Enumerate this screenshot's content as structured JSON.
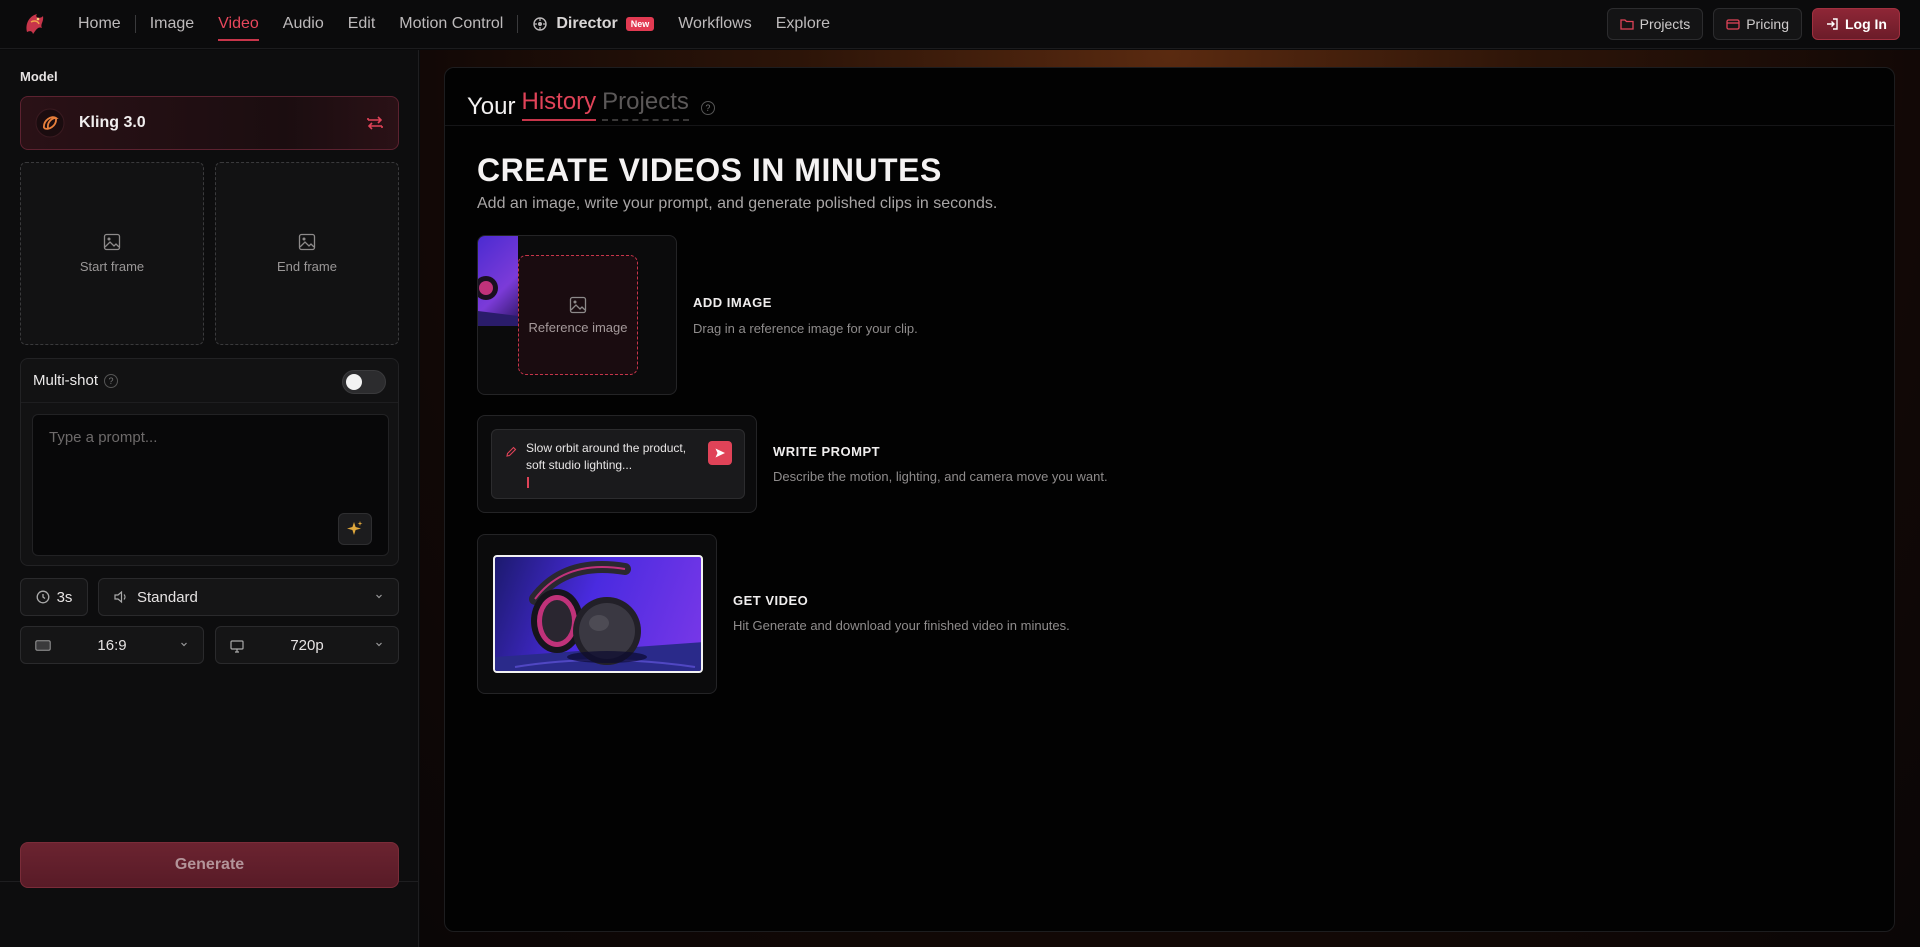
{
  "nav": {
    "items": [
      {
        "label": "Home"
      },
      {
        "label": "Image"
      },
      {
        "label": "Video"
      },
      {
        "label": "Audio"
      },
      {
        "label": "Edit"
      },
      {
        "label": "Motion Control"
      }
    ],
    "active": "Video",
    "director": {
      "label": "Director",
      "badge": "New"
    },
    "more": [
      {
        "label": "Workflows"
      },
      {
        "label": "Explore"
      }
    ]
  },
  "top_actions": {
    "projects": "Projects",
    "pricing": "Pricing",
    "login": "Log In"
  },
  "colors": {
    "accent": "#e04358",
    "accent_dark": "#6b1c29",
    "background": "#0a0a0b"
  },
  "sidebar": {
    "model_label": "Model",
    "model_name": "Kling 3.0",
    "start_frame": "Start frame",
    "end_frame": "End frame",
    "multishot_label": "Multi-shot",
    "multishot_enabled": false,
    "prompt_placeholder": "Type a prompt...",
    "duration": "3s",
    "audio_mode": "Standard",
    "aspect_ratio": "16:9",
    "resolution": "720p",
    "generate_label": "Generate"
  },
  "main": {
    "tabs": {
      "your": "Your",
      "history": "History",
      "projects": "Projects"
    },
    "title": "CREATE VIDEOS IN MINUTES",
    "subtitle": "Add an image, write your prompt, and generate polished clips in seconds.",
    "steps": [
      {
        "title": "ADD IMAGE",
        "desc": "Drag in a reference image for your clip.",
        "placeholder": "Reference image"
      },
      {
        "title": "WRITE PROMPT",
        "desc": "Describe the motion, lighting, and camera move you want.",
        "example_line1": "Slow orbit around the product,",
        "example_line2": "soft studio lighting..."
      },
      {
        "title": "GET VIDEO",
        "desc": "Hit Generate and download your finished video in minutes."
      }
    ]
  }
}
